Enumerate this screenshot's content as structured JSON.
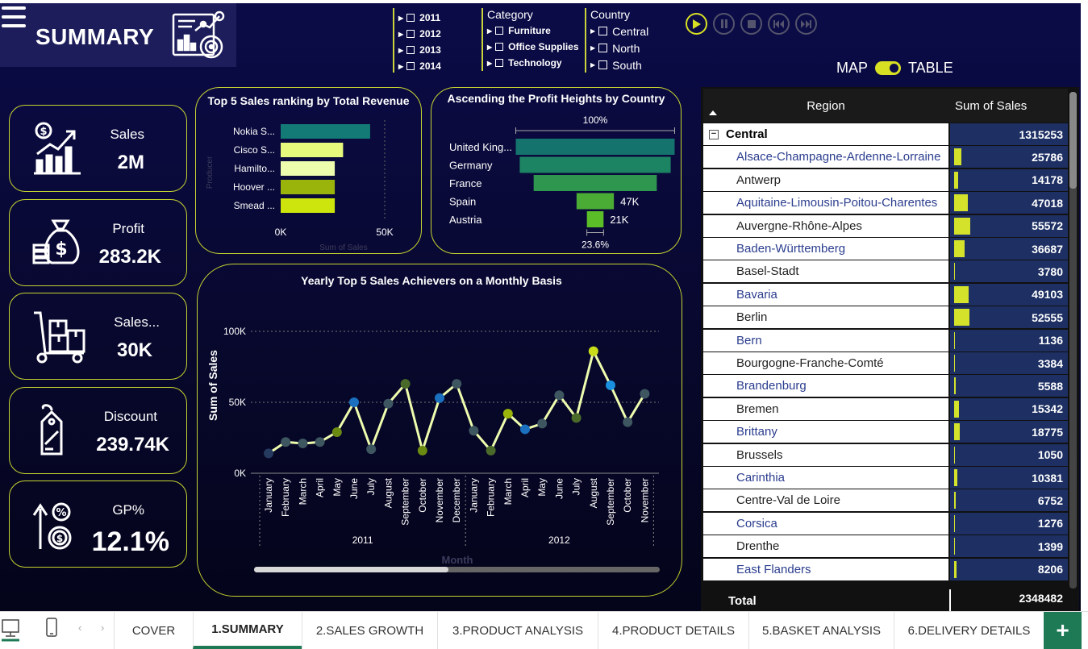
{
  "header": {
    "title": "SUMMARY"
  },
  "slicers": {
    "years": [
      "2011",
      "2012",
      "2013",
      "2014"
    ],
    "category": {
      "title": "Category",
      "items": [
        "Furniture",
        "Office Supplies",
        "Technology"
      ]
    },
    "country": {
      "title": "Country",
      "items": [
        "Central",
        "North",
        "South"
      ]
    }
  },
  "view_toggle": {
    "left": "MAP",
    "right": "TABLE"
  },
  "kpis": [
    {
      "label": "Sales",
      "value": "2M",
      "icon": "sales-chart-icon"
    },
    {
      "label": "Profit",
      "value": "283.2K",
      "icon": "money-bag-icon"
    },
    {
      "label": "Sales...",
      "value": "30K",
      "icon": "hand-truck-icon"
    },
    {
      "label": "Discount",
      "value": "239.74K",
      "icon": "price-tag-icon"
    },
    {
      "label": "GP%",
      "value": "12.1%",
      "icon": "percent-growth-icon"
    }
  ],
  "chart_data": [
    {
      "type": "bar",
      "orientation": "horizontal",
      "title": "Top 5 Sales ranking by Total Revenue",
      "categories": [
        "Nokia S...",
        "Cisco S...",
        "Hamilto...",
        "Hoover ...",
        "Smead ..."
      ],
      "values": [
        43000,
        30000,
        26000,
        26000,
        26000
      ],
      "colors": [
        "#137a76",
        "#e6f97c",
        "#eefcae",
        "#9ab40b",
        "#cde50c"
      ],
      "ylabel": "Producer",
      "xlabel": "Sum of Sales",
      "x_ticks": [
        "0K",
        "50K"
      ],
      "xlim": [
        0,
        50000
      ]
    },
    {
      "type": "bar",
      "subtype": "funnel",
      "title": "Ascending the Profit Heights by Country",
      "categories": [
        "United King...",
        "Germany",
        "France",
        "Spain",
        "Austria"
      ],
      "values": [
        200000,
        190000,
        155000,
        47000,
        21000
      ],
      "data_labels": [
        "",
        "",
        "",
        "47K",
        "21K"
      ],
      "top_label": "100%",
      "bottom_label": "23.6%",
      "colors": [
        "#14736d",
        "#1d8463",
        "#2f9650",
        "#4aab35",
        "#5bbd28"
      ]
    },
    {
      "type": "line",
      "title": "Yearly Top 5 Sales Achievers on a Monthly Basis",
      "ylabel": "Sum of Sales",
      "xlabel": "Month",
      "y_ticks": [
        "100K",
        "50K",
        "0K"
      ],
      "ylim": [
        0,
        100000
      ],
      "groups": [
        "2011",
        "2012"
      ],
      "x": [
        "January",
        "February",
        "March",
        "April",
        "May",
        "June",
        "July",
        "August",
        "September",
        "October",
        "November",
        "December",
        "January",
        "February",
        "March",
        "April",
        "May",
        "June",
        "July",
        "August",
        "September",
        "October",
        "November"
      ],
      "group_of_x": [
        0,
        0,
        0,
        0,
        0,
        0,
        0,
        0,
        0,
        0,
        0,
        0,
        1,
        1,
        1,
        1,
        1,
        1,
        1,
        1,
        1,
        1,
        1
      ],
      "values": [
        14000,
        22000,
        21000,
        22000,
        29000,
        50000,
        17000,
        49000,
        63000,
        16000,
        53000,
        63000,
        30000,
        16000,
        42000,
        31000,
        35000,
        55000,
        39000,
        86000,
        62000,
        36000,
        56000
      ],
      "point_colors": [
        "#243a5e",
        "#3d5660",
        "#3d5660",
        "#3d5660",
        "#6b8a12",
        "#1a6fbf",
        "#3d5660",
        "#3d5660",
        "#4a6a2a",
        "#6b8a12",
        "#1a6fbf",
        "#3d5660",
        "#3d5660",
        "#4a6a2a",
        "#9ab40b",
        "#1a6fbf",
        "#3d5660",
        "#3d5660",
        "#4a6a2a",
        "#c9dc1a",
        "#1a8fe0",
        "#3d5660",
        "#3d5660"
      ],
      "line_color": "#eefcae"
    }
  ],
  "table": {
    "col_region": "Region",
    "col_sales": "Sum of Sales",
    "group": {
      "name": "Central",
      "value": "1315253"
    },
    "rows": [
      {
        "region": "Alsace-Champagne-Ardenne-Lorraine",
        "sales": "25786",
        "v": 25786,
        "alt": true
      },
      {
        "region": "Antwerp",
        "sales": "14178",
        "v": 14178,
        "alt": false
      },
      {
        "region": "Aquitaine-Limousin-Poitou-Charentes",
        "sales": "47018",
        "v": 47018,
        "alt": true
      },
      {
        "region": "Auvergne-Rhône-Alpes",
        "sales": "55572",
        "v": 55572,
        "alt": false
      },
      {
        "region": "Baden-Württemberg",
        "sales": "36687",
        "v": 36687,
        "alt": true
      },
      {
        "region": "Basel-Stadt",
        "sales": "3780",
        "v": 3780,
        "alt": false
      },
      {
        "region": "Bavaria",
        "sales": "49103",
        "v": 49103,
        "alt": true
      },
      {
        "region": "Berlin",
        "sales": "52555",
        "v": 52555,
        "alt": false
      },
      {
        "region": "Bern",
        "sales": "1136",
        "v": 1136,
        "alt": true
      },
      {
        "region": "Bourgogne-Franche-Comté",
        "sales": "3384",
        "v": 3384,
        "alt": false
      },
      {
        "region": "Brandenburg",
        "sales": "5588",
        "v": 5588,
        "alt": true
      },
      {
        "region": "Bremen",
        "sales": "15342",
        "v": 15342,
        "alt": false
      },
      {
        "region": "Brittany",
        "sales": "18775",
        "v": 18775,
        "alt": true
      },
      {
        "region": "Brussels",
        "sales": "1050",
        "v": 1050,
        "alt": false
      },
      {
        "region": "Carinthia",
        "sales": "10381",
        "v": 10381,
        "alt": true
      },
      {
        "region": "Centre-Val de Loire",
        "sales": "6752",
        "v": 6752,
        "alt": false
      },
      {
        "region": "Corsica",
        "sales": "1276",
        "v": 1276,
        "alt": true
      },
      {
        "region": "Drenthe",
        "sales": "1399",
        "v": 1399,
        "alt": false
      },
      {
        "region": "East Flanders",
        "sales": "8206",
        "v": 8206,
        "alt": true
      }
    ],
    "total_label": "Total",
    "total_value": "2348482",
    "bar_max": 55572
  },
  "tabs": [
    "COVER",
    "1.SUMMARY",
    "2.SALES GROWTH",
    "3.PRODUCT ANALYSIS",
    "4.PRODUCT DETAILS",
    "5.BASKET ANALYSIS",
    "6.DELIVERY DETAILS"
  ],
  "active_tab": "1.SUMMARY",
  "colors": {
    "accent": "#c6d42f",
    "background": "#0b0b48",
    "tab_active": "#1d7a55"
  }
}
